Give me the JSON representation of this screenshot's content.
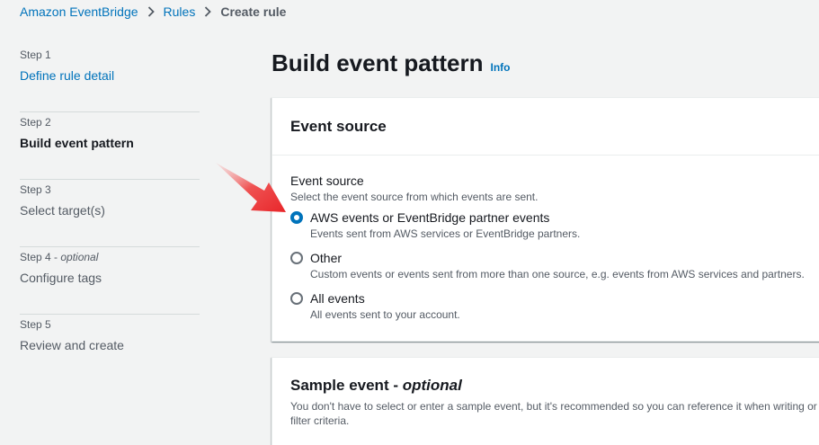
{
  "breadcrumb": {
    "items": [
      {
        "label": "Amazon EventBridge"
      },
      {
        "label": "Rules"
      },
      {
        "label": "Create rule"
      }
    ]
  },
  "steps": [
    {
      "number": "Step 1",
      "optional": "",
      "title": "Define rule detail",
      "state": "link"
    },
    {
      "number": "Step 2",
      "optional": "",
      "title": "Build event pattern",
      "state": "active"
    },
    {
      "number": "Step 3",
      "optional": "",
      "title": "Select target(s)",
      "state": "disabled"
    },
    {
      "number": "Step 4 - ",
      "optional": "optional",
      "title": "Configure tags",
      "state": "disabled"
    },
    {
      "number": "Step 5",
      "optional": "",
      "title": "Review and create",
      "state": "disabled"
    }
  ],
  "page": {
    "title": "Build event pattern",
    "info_label": "Info"
  },
  "event_source": {
    "panel_title": "Event source",
    "field_label": "Event source",
    "field_description": "Select the event source from which events are sent.",
    "options": [
      {
        "label": "AWS events or EventBridge partner events",
        "description": "Events sent from AWS services or EventBridge partners.",
        "selected": true
      },
      {
        "label": "Other",
        "description": "Custom events or events sent from more than one source, e.g. events from AWS services and partners.",
        "selected": false
      },
      {
        "label": "All events",
        "description": "All events sent to your account.",
        "selected": false
      }
    ]
  },
  "sample_event": {
    "title": "Sample event - ",
    "title_optional": "optional",
    "description": "You don't have to select or enter a sample event, but it's recommended so you can reference it when writing or filter criteria."
  },
  "colors": {
    "link": "#0073bb",
    "background": "#f2f3f3",
    "annotation_arrow": "#e8262a"
  },
  "icons": {
    "breadcrumb_separator": "chevron-right-icon",
    "annotation": "red-arrow-icon"
  }
}
